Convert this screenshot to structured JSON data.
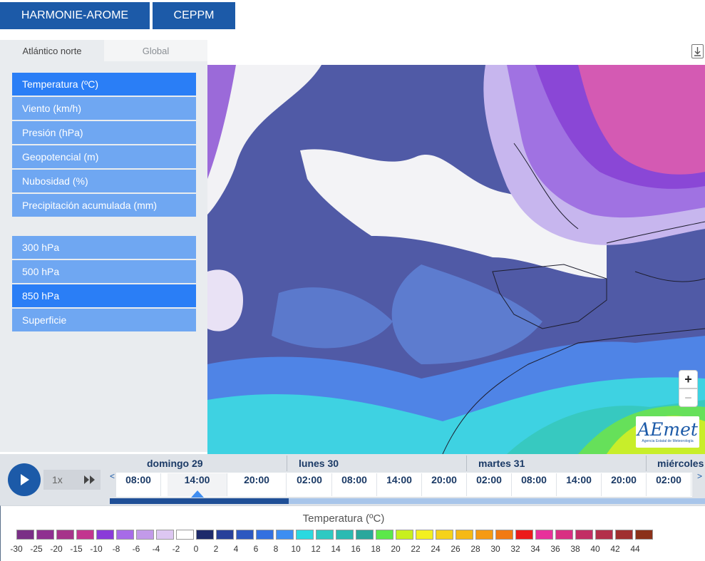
{
  "models": [
    {
      "label": "HARMONIE-AROME",
      "active": true
    },
    {
      "label": "CEPPM",
      "active": false
    }
  ],
  "regions": [
    {
      "label": "Atlántico norte",
      "active": true
    },
    {
      "label": "Global",
      "active": false
    }
  ],
  "variables": [
    {
      "label": "Temperatura (ºC)",
      "active": true
    },
    {
      "label": "Viento (km/h)",
      "active": false
    },
    {
      "label": "Presión (hPa)",
      "active": false
    },
    {
      "label": "Geopotencial (m)",
      "active": false
    },
    {
      "label": "Nubosidad (%)",
      "active": false
    },
    {
      "label": "Precipitación acumulada (mm)",
      "active": false
    }
  ],
  "levels": [
    {
      "label": "300 hPa",
      "active": false
    },
    {
      "label": "500 hPa",
      "active": false
    },
    {
      "label": "850 hPa",
      "active": true
    },
    {
      "label": "Superficie",
      "active": false
    }
  ],
  "map": {
    "zoom_in": "+",
    "zoom_out": "−",
    "logo_text": "AEmet",
    "logo_subtext": "Agencia Estatal de Meteorología",
    "download_icon": "download-icon"
  },
  "player": {
    "speed": "1x",
    "prev": "<",
    "next": ">",
    "progress": 0.3
  },
  "days": [
    "domingo 29",
    "lunes 30",
    "martes 31",
    "miércoles"
  ],
  "hours": [
    "08:00",
    "14:00",
    "20:00",
    "02:00",
    "08:00",
    "14:00",
    "20:00",
    "02:00",
    "08:00",
    "14:00",
    "20:00",
    "02:00"
  ],
  "selected_hour_index": 1,
  "legend": {
    "title": "Temperatura (ºC)",
    "colors": [
      "#7a2f86",
      "#8f3090",
      "#a6338a",
      "#c2358f",
      "#8a3ad9",
      "#a76be8",
      "#c29ae9",
      "#ddc7f2",
      "#ffffff",
      "#1d2a6b",
      "#27409a",
      "#2d58c0",
      "#3370e0",
      "#3d8ef2",
      "#2ad9e0",
      "#2ec9c2",
      "#2bbab2",
      "#2aa79c",
      "#5ce84a",
      "#c8ef1f",
      "#f3f020",
      "#f5d21b",
      "#f5b916",
      "#f59a13",
      "#f27a12",
      "#ec1b1b",
      "#e8319b",
      "#d92f82",
      "#c22e64",
      "#b32f4a",
      "#a02f2f",
      "#8b3119"
    ],
    "labels": [
      "-30",
      "-25",
      "-20",
      "-15",
      "-10",
      "-8",
      "-6",
      "-4",
      "-2",
      "0",
      "2",
      "4",
      "6",
      "8",
      "10",
      "12",
      "14",
      "16",
      "18",
      "20",
      "22",
      "24",
      "26",
      "28",
      "30",
      "32",
      "34",
      "36",
      "38",
      "40",
      "42",
      "44"
    ]
  }
}
